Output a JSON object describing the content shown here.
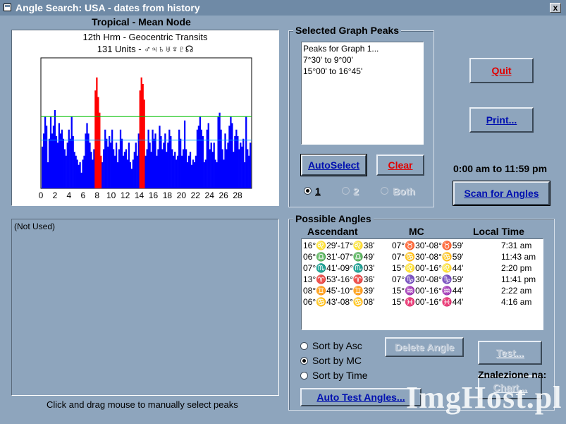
{
  "window": {
    "title": "Angle Search: USA - dates from history",
    "close_label": "x"
  },
  "graph": {
    "header": "Tropical - Mean Node",
    "line1": "12th Hrm - Geocentric Transits",
    "line2": "131 Units - ♂♃♄♅♆♇☊",
    "footer": "Click and drag mouse to manually select peaks",
    "x_ticks": [
      "0",
      "2",
      "4",
      "6",
      "8",
      "10",
      "12",
      "14",
      "16",
      "18",
      "20",
      "22",
      "24",
      "26",
      "28"
    ]
  },
  "chart_data": {
    "type": "bar",
    "x_range": [
      0,
      30
    ],
    "y_range": [
      0,
      100
    ],
    "thresholds": [
      {
        "value": 55,
        "color": "#00c000"
      },
      {
        "value": 37,
        "color": "#00a0ff"
      }
    ],
    "bar_colors": {
      "normal": "#0000ff",
      "peak": "#ff0000"
    },
    "values": [
      32,
      42,
      55,
      48,
      20,
      38,
      55,
      42,
      48,
      60,
      40,
      35,
      50,
      42,
      45,
      38,
      30,
      25,
      35,
      45,
      38,
      55,
      40,
      28,
      25,
      22,
      18,
      20,
      12,
      22,
      25,
      42,
      50,
      42,
      35,
      28,
      22,
      30,
      75,
      85,
      70,
      58,
      25,
      20,
      30,
      45,
      38,
      32,
      40,
      35,
      45,
      30,
      25,
      35,
      20,
      30,
      45,
      38,
      25,
      28,
      30,
      22,
      35,
      20,
      15,
      22,
      28,
      35,
      25,
      42,
      75,
      85,
      80,
      68,
      25,
      30,
      45,
      35,
      28,
      45,
      38,
      42,
      25,
      30,
      48,
      40,
      30,
      35,
      42,
      28,
      35,
      45,
      40,
      30,
      25,
      28,
      22,
      25,
      45,
      38,
      25,
      30,
      52,
      30,
      20,
      25,
      28,
      18,
      22,
      20,
      25,
      45,
      48,
      55,
      45,
      40,
      20,
      22,
      45,
      50,
      30,
      35,
      28,
      35,
      22,
      20,
      55,
      58,
      45,
      30,
      22,
      42,
      30,
      35,
      48,
      55,
      50,
      28,
      40,
      45,
      40,
      30,
      35,
      32,
      38,
      20,
      55,
      30,
      25,
      35
    ],
    "peaks": [
      [
        38,
        42
      ],
      [
        70,
        73
      ]
    ]
  },
  "peaks": {
    "title": "Selected Graph Peaks",
    "lines": [
      "Peaks for Graph 1...",
      "7°30' to 9°00'",
      "15°00' to 16°45'"
    ],
    "autoselect_label": "AutoSelect",
    "clear_label": "Clear",
    "radio": [
      {
        "label": "1",
        "checked": true
      },
      {
        "label": "2",
        "checked": false
      },
      {
        "label": "Both",
        "checked": false
      }
    ]
  },
  "buttons": {
    "quit": "Quit",
    "print": "Print...",
    "time_range": "0:00 am to 11:59 pm",
    "scan": "Scan for Angles",
    "delete": "Delete Angle",
    "test": "Test...",
    "chart": "Chart...",
    "auto_test": "Auto Test Angles..."
  },
  "unused_panel": "(Not Used)",
  "angles": {
    "title": "Possible Angles",
    "headers": [
      "Ascendant",
      "MC",
      "Local Time"
    ],
    "rows": [
      [
        "16°♌29'-17°♌38'",
        "07°♉30'-08°♉59'",
        "7:31 am"
      ],
      [
        "06°♎31'-07°♎49'",
        "07°♋30'-08°♋59'",
        "11:43 am"
      ],
      [
        "07°♏41'-09°♏03'",
        "15°♌00'-16°♌44'",
        "2:20 pm"
      ],
      [
        "13°♈53'-16°♈36'",
        "07°♑30'-08°♑59'",
        "11:41 pm"
      ],
      [
        "08°♊45'-10°♊39'",
        "15°♒00'-16°♒44'",
        "2:22 am"
      ],
      [
        "06°♋43'-08°♋08'",
        "15°♓00'-16°♓44'",
        "4:16 am"
      ]
    ],
    "sort": [
      {
        "label": "Sort by Asc",
        "checked": false
      },
      {
        "label": "Sort by MC",
        "checked": true
      },
      {
        "label": "Sort by Time",
        "checked": false
      }
    ]
  },
  "watermark": {
    "line1": "Znalezione na:",
    "line2": "ImgHost.pl"
  }
}
